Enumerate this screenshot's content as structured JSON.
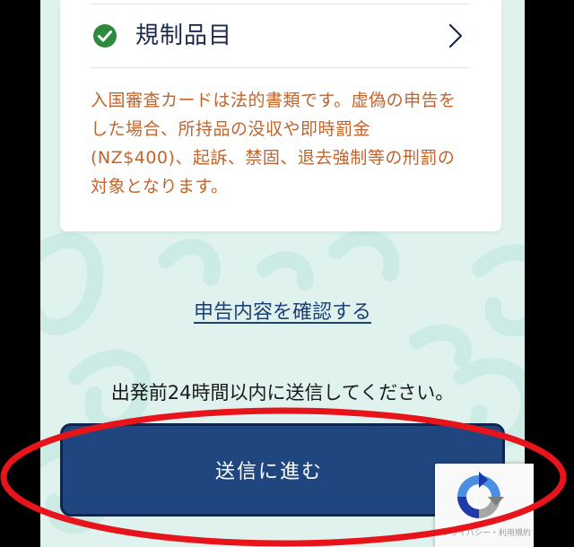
{
  "card": {
    "item_label": "規制品目",
    "warning_lines": [
      "入国審査カードは法的書類です。虚偽の申告を",
      "した場合、所持品の没収や即時罰金",
      "(NZ$400)、起訴、禁固、退去強制等の刑罰の",
      "対象となります。"
    ]
  },
  "review_link": "申告内容を確認する",
  "instruction": "出発前24時間以内に送信してください。",
  "proceed_button": "送信に進む",
  "recaptcha": {
    "text": "プライバシー・利用規約"
  },
  "colors": {
    "check_green": "#2e8b3e",
    "button_navy": "#20467f",
    "warning_orange": "#c2642b",
    "link_blue": "#1e4079",
    "highlight_red": "#e8141c",
    "background_mint": "#dff2ee"
  },
  "icons": {
    "item_status": "check-circle-icon",
    "item_chevron": "chevron-right-icon",
    "recaptcha": "recaptcha-icon"
  }
}
